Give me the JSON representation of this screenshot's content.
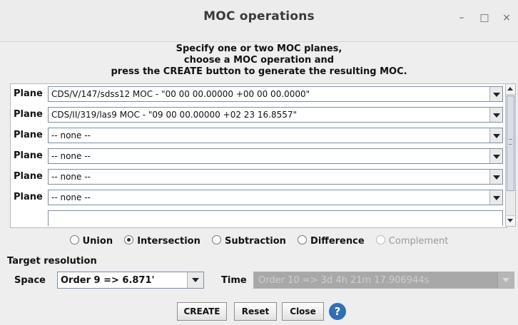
{
  "window": {
    "title": "MOC operations",
    "minimize_glyph": "–",
    "maximize_glyph": "□",
    "close_glyph": "×"
  },
  "instructions": [
    "Specify one or two MOC planes,",
    "choose a MOC operation and",
    "press the CREATE button to generate the resulting MOC."
  ],
  "planes": {
    "label": "Plane",
    "rows": [
      "CDS/V/147/sdss12 MOC - \"00 00 00.00000 +00 00 00.0000\"",
      "CDS/II/319/las9 MOC - \"09 00 00.00000 +02 23 16.8557\"",
      "-- none --",
      "-- none --",
      "-- none --",
      "-- none --"
    ]
  },
  "operations": [
    {
      "label": "Union",
      "selected": false,
      "enabled": true
    },
    {
      "label": "Intersection",
      "selected": true,
      "enabled": true
    },
    {
      "label": "Subtraction",
      "selected": false,
      "enabled": true
    },
    {
      "label": "Difference",
      "selected": false,
      "enabled": true
    },
    {
      "label": "Complement",
      "selected": false,
      "enabled": false
    }
  ],
  "target": {
    "label": "Target resolution",
    "space_label": "Space",
    "space_value": "Order 9 => 6.871'",
    "time_label": "Time",
    "time_value": "Order 10 => 3d 4h 21m 17.906944s"
  },
  "buttons": {
    "create": "CREATE",
    "reset": "Reset",
    "close": "Close",
    "help": "?"
  },
  "colors": {
    "help_icon": "#2f6fb6",
    "disabled_field": "#a8a8a8"
  }
}
